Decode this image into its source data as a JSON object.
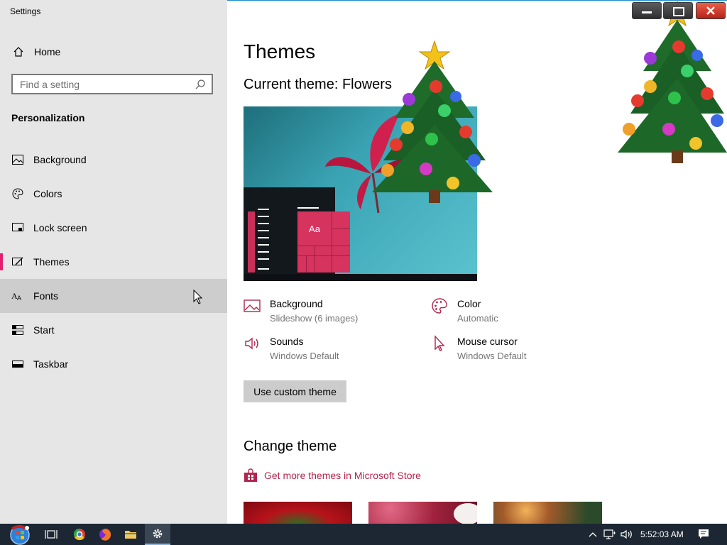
{
  "window": {
    "title": "Settings"
  },
  "sidebar": {
    "home_label": "Home",
    "search_placeholder": "Find a setting",
    "section_title": "Personalization",
    "items": [
      {
        "label": "Background",
        "icon": "picture-icon"
      },
      {
        "label": "Colors",
        "icon": "palette-icon"
      },
      {
        "label": "Lock screen",
        "icon": "lock-screen-icon"
      },
      {
        "label": "Themes",
        "icon": "themes-icon",
        "selected": true
      },
      {
        "label": "Fonts",
        "icon": "fonts-icon",
        "hovered": true
      },
      {
        "label": "Start",
        "icon": "start-icon"
      },
      {
        "label": "Taskbar",
        "icon": "taskbar-icon"
      }
    ]
  },
  "main": {
    "title": "Themes",
    "current_theme_label": "Current theme:",
    "current_theme_name": "Flowers",
    "preview_tile_text": "Aa",
    "properties": [
      {
        "label": "Background",
        "value": "Slideshow (6 images)",
        "icon": "picture-icon"
      },
      {
        "label": "Color",
        "value": "Automatic",
        "icon": "palette-icon"
      },
      {
        "label": "Sounds",
        "value": "Windows Default",
        "icon": "speaker-icon"
      },
      {
        "label": "Mouse cursor",
        "value": "Windows Default",
        "icon": "cursor-icon"
      }
    ],
    "custom_button": "Use custom theme",
    "change_theme_title": "Change theme",
    "store_link": "Get more themes in Microsoft Store"
  },
  "taskbar": {
    "clock": "5:52:03 AM",
    "icons": [
      "start-orb-icon",
      "task-view-icon",
      "chrome-icon",
      "firefox-icon",
      "file-explorer-icon",
      "settings-gear-icon"
    ]
  },
  "colors": {
    "accent": "#e2206f",
    "link": "#b0264d",
    "sidebar_bg": "#e6e6e6",
    "taskbar_bg": "#1c2733"
  }
}
